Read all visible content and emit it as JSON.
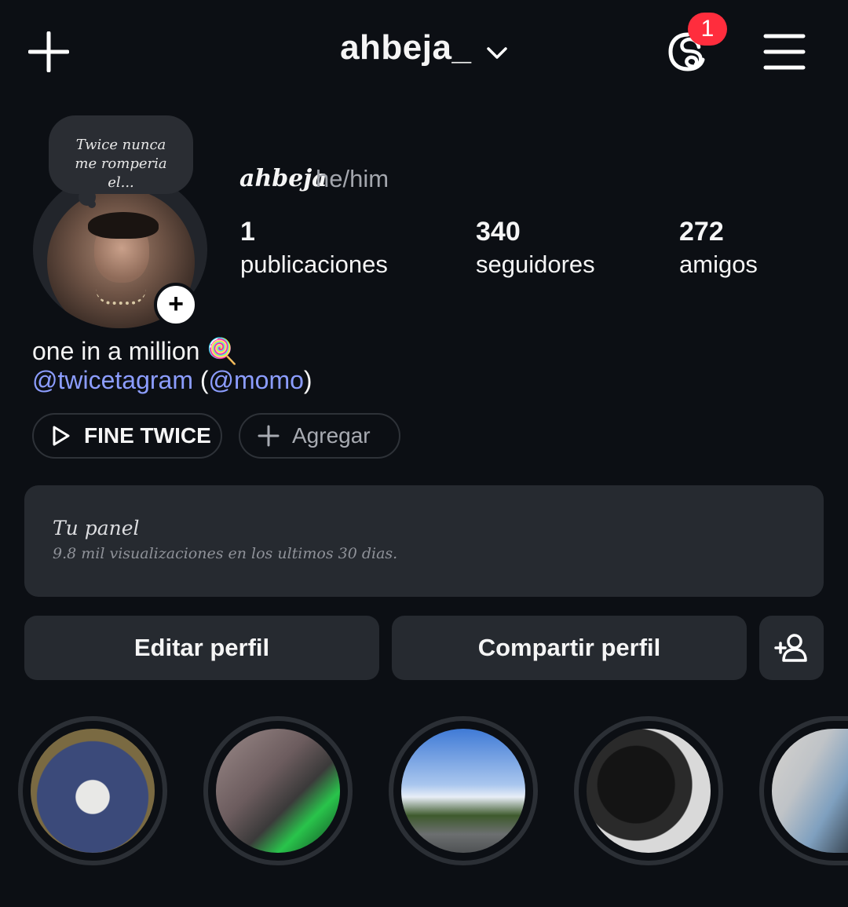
{
  "header": {
    "username": "ahbeja_",
    "threads_badge_count": "1"
  },
  "profile": {
    "note": "Twice nunca me romperia el...",
    "display_name": "ahbeja",
    "pronouns": "he/him",
    "stats": [
      {
        "value": "1",
        "label": "publicaciones"
      },
      {
        "value": "340",
        "label": "seguidores"
      },
      {
        "value": "272",
        "label": "amigos"
      }
    ],
    "bio_line1": "one in a million 🍭",
    "bio_mentions": {
      "mention1": "@twicetagram",
      "open_paren": " (",
      "mention2": "@momo",
      "close_paren": ")"
    }
  },
  "chips": {
    "music_label": "FINE TWICE",
    "add_label": "Agregar"
  },
  "dashboard": {
    "title": "Tu panel",
    "subtitle": "9.8 mil visualizaciones en los ultimos 30 dias."
  },
  "actions": {
    "edit_label": "Editar perfil",
    "share_label": "Compartir perfil"
  },
  "highlights_count": 5,
  "colors": {
    "background": "#0c0f14",
    "surface": "#262a30",
    "mention": "#8c9dff",
    "badge": "#ff2d3d"
  },
  "icons": [
    "plus-icon",
    "chevron-down-icon",
    "threads-icon",
    "menu-icon",
    "add-story-icon",
    "play-icon",
    "add-icon",
    "add-person-icon"
  ]
}
